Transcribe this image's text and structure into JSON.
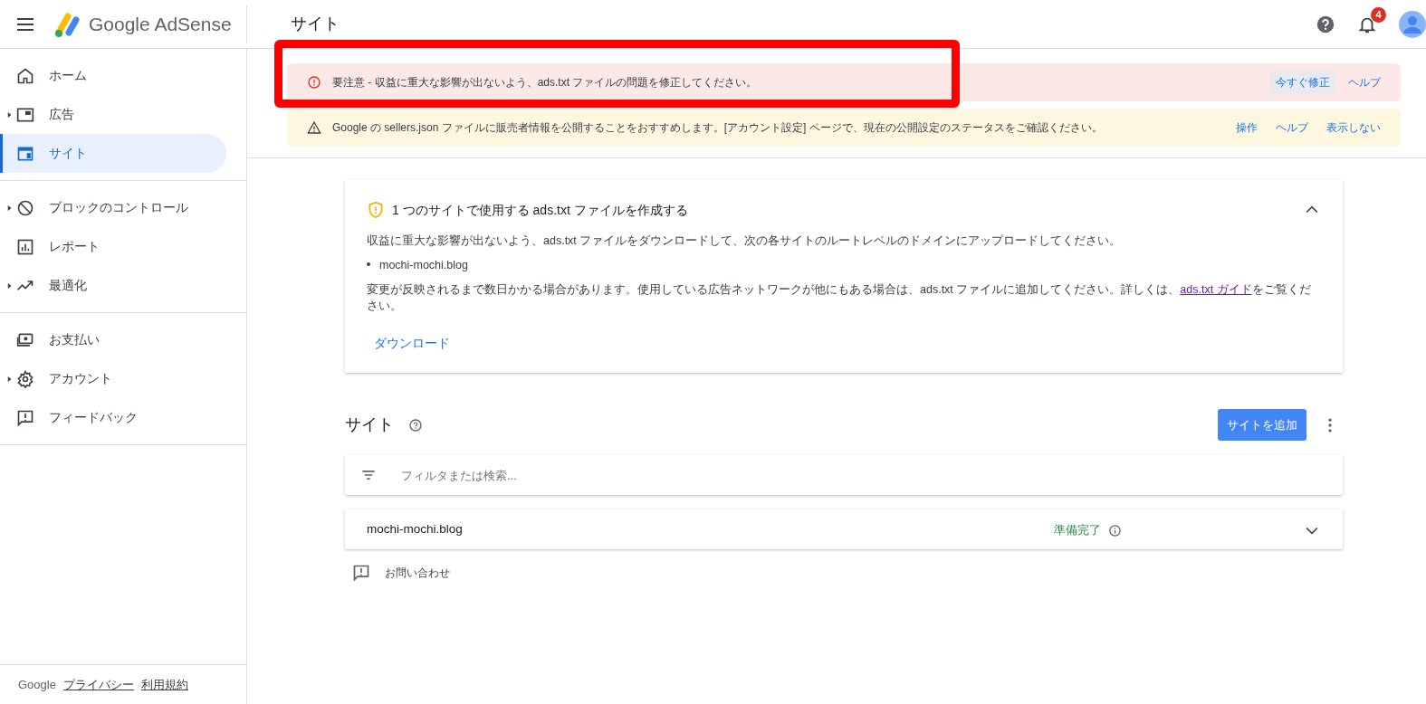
{
  "header": {
    "product": "Google AdSense",
    "page_title": "サイト",
    "notification_count": "4"
  },
  "sidebar": {
    "groups": [
      {
        "items": [
          {
            "label": "ホーム",
            "expandable": false,
            "selected": false
          },
          {
            "label": "広告",
            "expandable": true,
            "selected": false
          },
          {
            "label": "サイト",
            "expandable": false,
            "selected": true
          }
        ]
      },
      {
        "items": [
          {
            "label": "ブロックのコントロール",
            "expandable": true,
            "selected": false
          },
          {
            "label": "レポート",
            "expandable": false,
            "selected": false
          },
          {
            "label": "最適化",
            "expandable": true,
            "selected": false
          }
        ]
      },
      {
        "items": [
          {
            "label": "お支払い",
            "expandable": false,
            "selected": false
          },
          {
            "label": "アカウント",
            "expandable": true,
            "selected": false
          },
          {
            "label": "フィードバック",
            "expandable": false,
            "selected": false
          }
        ]
      }
    ],
    "footer": {
      "brand": "Google",
      "links": [
        "プライバシー",
        "利用規約"
      ]
    }
  },
  "alerts": [
    {
      "kind": "error",
      "highlighted": true,
      "text": "要注意 - 収益に重大な影響が出ないよう、ads.txt ファイルの問題を修正してください。",
      "actions": [
        {
          "label": "今すぐ修正",
          "focused": true
        },
        {
          "label": "ヘルプ",
          "focused": false
        }
      ]
    },
    {
      "kind": "warning",
      "highlighted": false,
      "text": "Google の sellers.json ファイルに販売者情報を公開することをおすすめします。[アカウント設定] ページで、現在の公開設定のステータスをご確認ください。",
      "actions": [
        {
          "label": "操作",
          "focused": false
        },
        {
          "label": "ヘルプ",
          "focused": false
        },
        {
          "label": "表示しない",
          "focused": false
        }
      ]
    }
  ],
  "ads_txt_card": {
    "title": "1 つのサイトで使用する ads.txt ファイルを作成する",
    "expanded": true,
    "intro": "収益に重大な影響が出ないよう、ads.txt ファイルをダウンロードして、次の各サイトのルートレベルのドメインにアップロードしてください。",
    "sites": [
      "mochi-mochi.blog"
    ],
    "note": "変更が反映されるまで数日かかる場合があります。使用している広告ネットワークが他にもある場合は、ads.txt ファイルに追加してください。詳しくは、",
    "link": "ads.txt ガイド",
    "note_end": "をご覧ください。",
    "download": "ダウンロード"
  },
  "sites_section": {
    "title": "サイト",
    "add_button": "サイトを追加",
    "filter": {
      "placeholder": "フィルタまたは検索..."
    },
    "rows": [
      {
        "site": "mochi-mochi.blog",
        "status": "準備完了",
        "expanded": false
      }
    ],
    "contact": "お問い合わせ"
  }
}
